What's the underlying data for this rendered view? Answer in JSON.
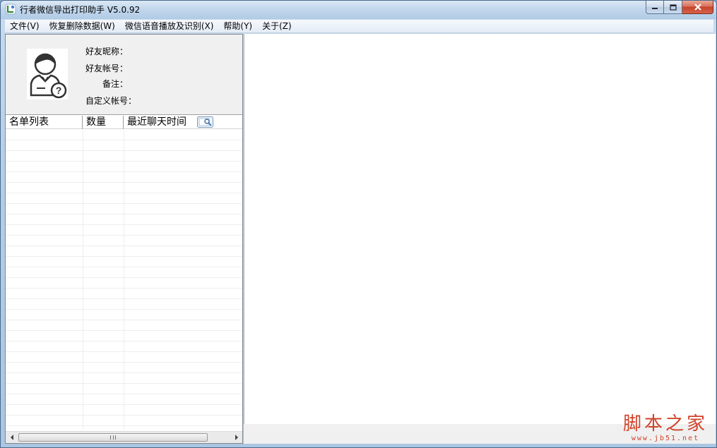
{
  "window": {
    "title": "行者微信导出打印助手  V5.0.92"
  },
  "menu": {
    "items": [
      {
        "label": "文件(V)"
      },
      {
        "label": "恢复删除数据(W)"
      },
      {
        "label": "微信语音播放及识别(X)"
      },
      {
        "label": "帮助(Y)"
      },
      {
        "label": "关于(Z)"
      }
    ]
  },
  "profile": {
    "nickname_label": "好友昵称：",
    "account_label": "好友帐号：",
    "remark_label": "备注：",
    "custom_account_label": "自定义帐号："
  },
  "list": {
    "columns": [
      {
        "label": "名单列表"
      },
      {
        "label": "数量"
      },
      {
        "label": "最近聊天时间"
      }
    ],
    "scroll_grip": "Ⅲ"
  },
  "watermark": {
    "main": "脚本之家",
    "sub": "www.jb51.net"
  },
  "icons": {
    "app": "app-logo-icon",
    "avatar": "user-unknown-icon",
    "search": "search-icon"
  },
  "colors": {
    "watermark": "#d0432a",
    "close_button": "#c5432a"
  }
}
